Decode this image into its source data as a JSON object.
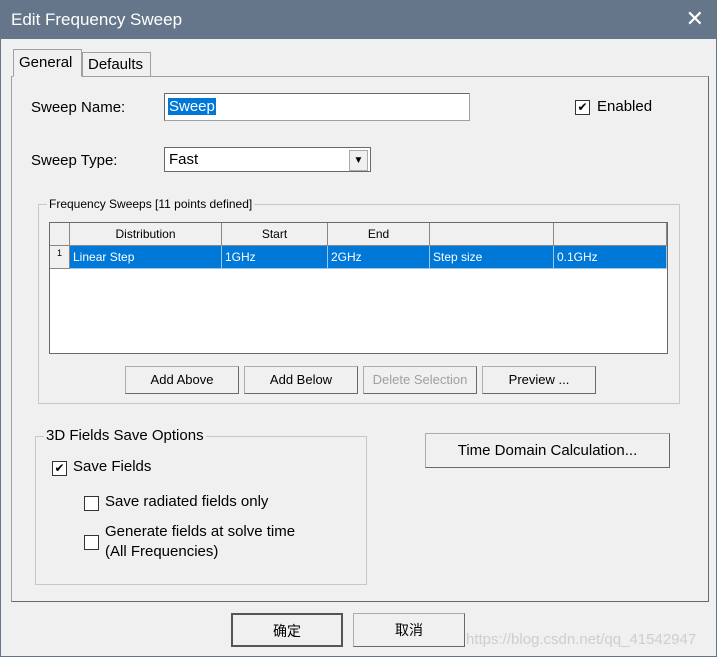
{
  "window": {
    "title": "Edit Frequency Sweep"
  },
  "tabs": [
    {
      "label": "General",
      "active": true
    },
    {
      "label": "Defaults",
      "active": false
    }
  ],
  "general": {
    "sweep_name_label": "Sweep Name:",
    "sweep_name_value": "Sweep",
    "enabled_label": "Enabled",
    "enabled_checked": true,
    "sweep_type_label": "Sweep Type:",
    "sweep_type_value": "Fast"
  },
  "freq_sweeps": {
    "title": "Frequency Sweeps [11 points defined]",
    "columns": [
      "Distribution",
      "Start",
      "End",
      "",
      ""
    ],
    "rows": [
      {
        "num": "1",
        "cells": [
          "Linear Step",
          "1GHz",
          "2GHz",
          "Step size",
          "0.1GHz"
        ]
      }
    ],
    "buttons": {
      "add_above": "Add Above",
      "add_below": "Add Below",
      "delete": "Delete Selection",
      "preview": "Preview ..."
    }
  },
  "fields3d": {
    "title": "3D Fields Save Options",
    "save_fields": "Save Fields",
    "save_fields_checked": true,
    "radiated_only": "Save radiated fields only",
    "radiated_only_checked": false,
    "generate_line1": "Generate fields at solve time",
    "generate_line2": "(All Frequencies)",
    "generate_checked": false
  },
  "time_domain_button": "Time Domain Calculation...",
  "footer": {
    "ok": "确定",
    "cancel": "取消",
    "watermark": "https://blog.csdn.net/qq_41542947"
  },
  "colors": {
    "titlebar": "#66768a",
    "selection": "#0078d7"
  }
}
